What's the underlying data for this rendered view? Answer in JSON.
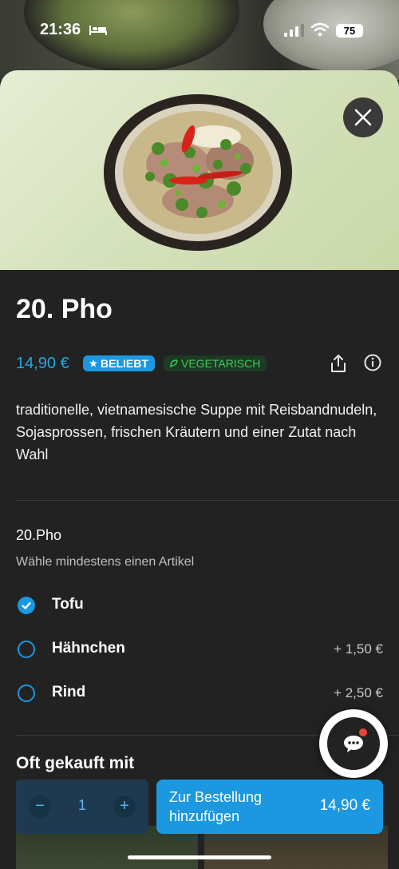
{
  "status": {
    "time": "21:36",
    "battery": "75"
  },
  "item": {
    "title": "20. Pho",
    "price": "14,90 €",
    "badge_popular": "BELIEBT",
    "badge_vegetarian": "VEGETARISCH",
    "description": "traditionelle, vietnamesische Suppe mit Reisbandnudeln, Sojasprossen, frischen Kräutern und einer Zutat nach Wahl"
  },
  "options_group": {
    "title": "20.Pho",
    "subtitle": "Wähle mindestens einen Artikel",
    "options": [
      {
        "label": "Tofu",
        "price": "",
        "selected": true
      },
      {
        "label": "Hähnchen",
        "price": "+ 1,50 €",
        "selected": false
      },
      {
        "label": "Rind",
        "price": "+ 2,50 €",
        "selected": false
      }
    ]
  },
  "frequently_bought": {
    "title": "Oft gekauft mit"
  },
  "cart": {
    "quantity": "1",
    "minus": "−",
    "plus": "+",
    "add_label": "Zur Bestellung hinzufügen",
    "add_price": "14,90 €"
  },
  "colors": {
    "accent": "#1b98e0",
    "vegetarian": "#3ecb5b",
    "background": "#222222"
  },
  "icons": [
    "bed-icon",
    "signal-icon",
    "wifi-icon",
    "close-icon",
    "star-icon",
    "leaf-icon",
    "share-icon",
    "info-icon",
    "check-icon",
    "chat-icon"
  ]
}
